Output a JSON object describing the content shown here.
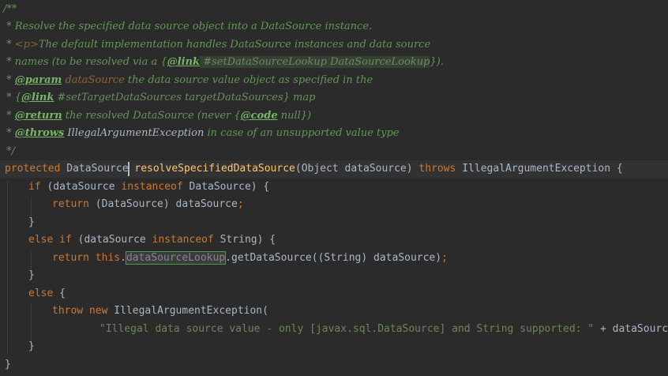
{
  "javadoc": {
    "open": "/**",
    "line1": " * Resolve the specified data source object into a DataSource instance.",
    "line2_star": " * ",
    "line2_tag": "<p>",
    "line2_text": "The default implementation handles DataSource instances and data source",
    "line3_prefix": " * names (to be resolved via a {",
    "line3_link": "@link",
    "line3_ref": " #setDataSourceLookup DataSourceLookup",
    "line3_suffix": "}).",
    "line4_star": " * ",
    "line4_tag": "@param",
    "line4_param": " dataSource",
    "line4_text": " the data source value object as specified in the",
    "line5_prefix": " * {",
    "line5_link": "@link",
    "line5_ref": " #setTargetDataSources targetDataSources",
    "line5_suffix": "} map",
    "line6_star": " * ",
    "line6_tag": "@return",
    "line6_text": " the resolved DataSource (never {",
    "line6_code": "@code",
    "line6_suffix": " null})",
    "line7_star": " * ",
    "line7_tag": "@throws",
    "line7_exc": " IllegalArgumentException",
    "line7_text": " in case of an unsupported value type",
    "close": " */"
  },
  "code": {
    "sig_kw": "protected",
    "sig_type": " DataSource ",
    "sig_name": "resolveSpecifiedDataSource",
    "sig_params": "(Object dataSource) ",
    "sig_throws": "throws",
    "sig_exc": " IllegalArgumentException {",
    "if1_kw": "if",
    "if1_a": " (dataSource ",
    "if1_inst": "instanceof",
    "if1_b": " DataSource) {",
    "ret1_kw": "return",
    "ret1_expr": " (DataSource) dataSource",
    "semi": ";",
    "close_brace": "}",
    "else_kw": "else",
    "if2_kw": "if",
    "if2_a": " (dataSource ",
    "if2_inst": "instanceof",
    "if2_b": " String) {",
    "ret2_kw": "return",
    "ret2_this": " this",
    "ret2_dot": ".",
    "ret2_field": "dataSourceLookup",
    "ret2_rest": ".getDataSource((String) dataSource)",
    "else2_brace": " {",
    "throw_kw": "throw",
    "new_kw": " new",
    "throw_exc": " IllegalArgumentException(",
    "msg": "\"Illegal data source value - only [javax.sql.DataSource] and String supported: \"",
    "msg_rest": " + dataSource)",
    "final_brace": "}"
  },
  "watermark": ""
}
